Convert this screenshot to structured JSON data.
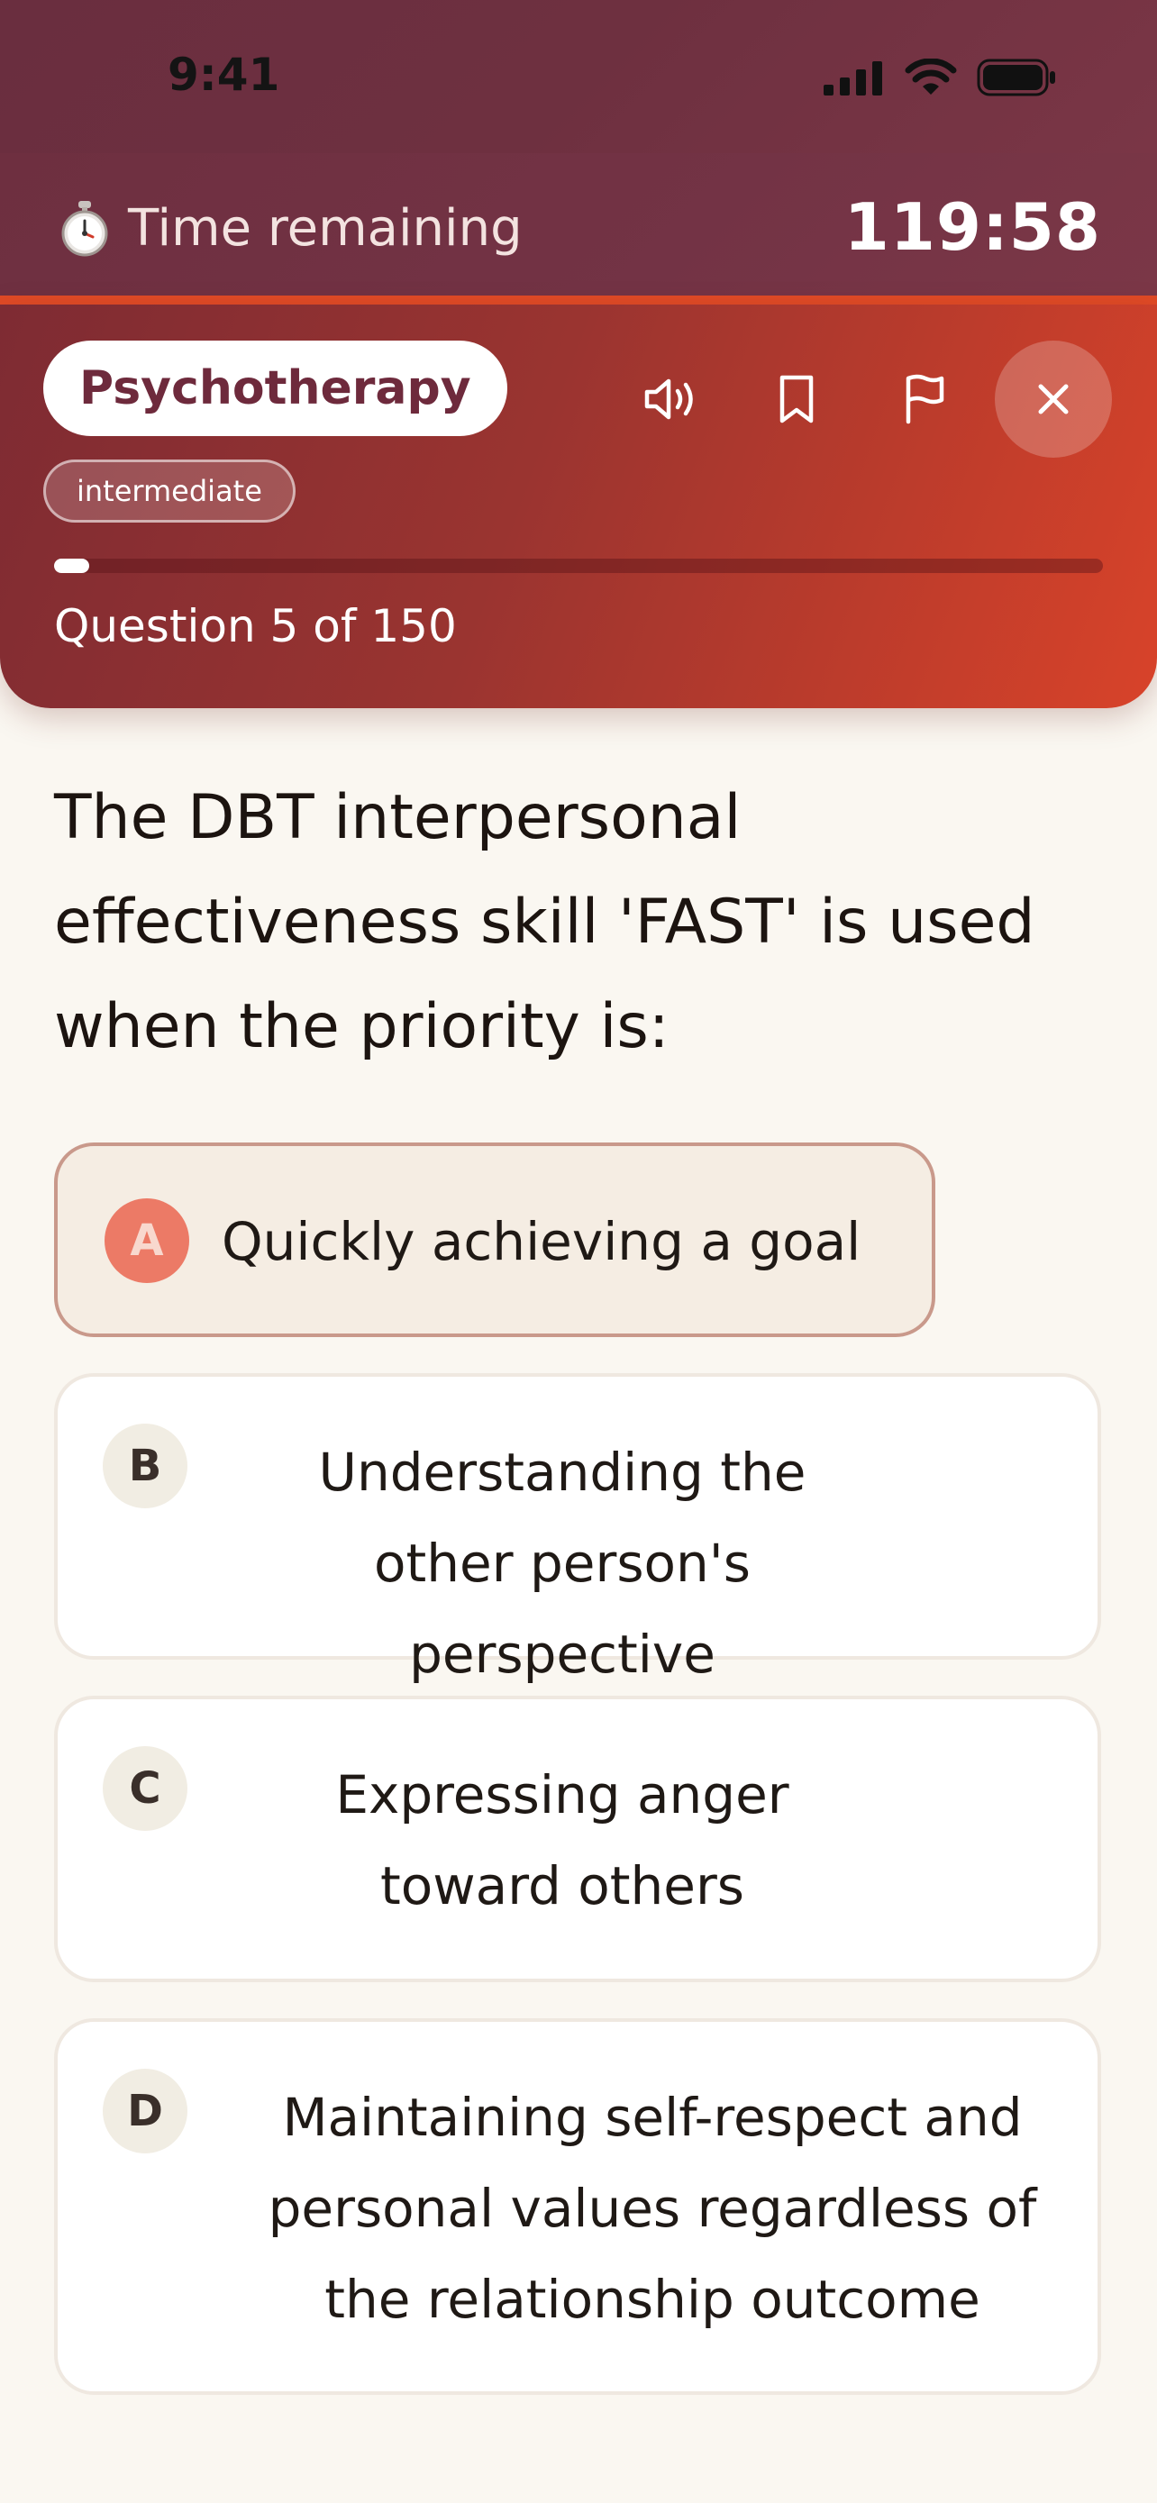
{
  "status_bar": {
    "time": "9:41"
  },
  "timer": {
    "icon": "stopwatch-icon",
    "label": "Time remaining",
    "value": "119:58"
  },
  "header": {
    "subject": "Psychotherapy",
    "level": "intermediate",
    "icons": [
      "speaker-icon",
      "bookmark-icon",
      "flag-icon",
      "close-icon"
    ],
    "progress_fraction": 0.0333,
    "progress_text": "Question 5 of 150"
  },
  "question": {
    "text": "The DBT interpersonal effectiveness skill 'FAST' is used when the priority is:"
  },
  "options": [
    {
      "letter": "A",
      "text": "Quickly achieving a goal",
      "selected": true
    },
    {
      "letter": "B",
      "text": "Understanding the other person's perspective",
      "selected": false
    },
    {
      "letter": "C",
      "text": "Expressing anger toward others",
      "selected": false
    },
    {
      "letter": "D",
      "text": "Maintaining self-respect and personal values regardless of the relationship outcome",
      "selected": false
    }
  ],
  "colors": {
    "accent_orange": "#E04A26",
    "header_dark": "#6E2F40",
    "subject_text": "#6E2A3C",
    "selected_badge": "#EC7A66"
  }
}
